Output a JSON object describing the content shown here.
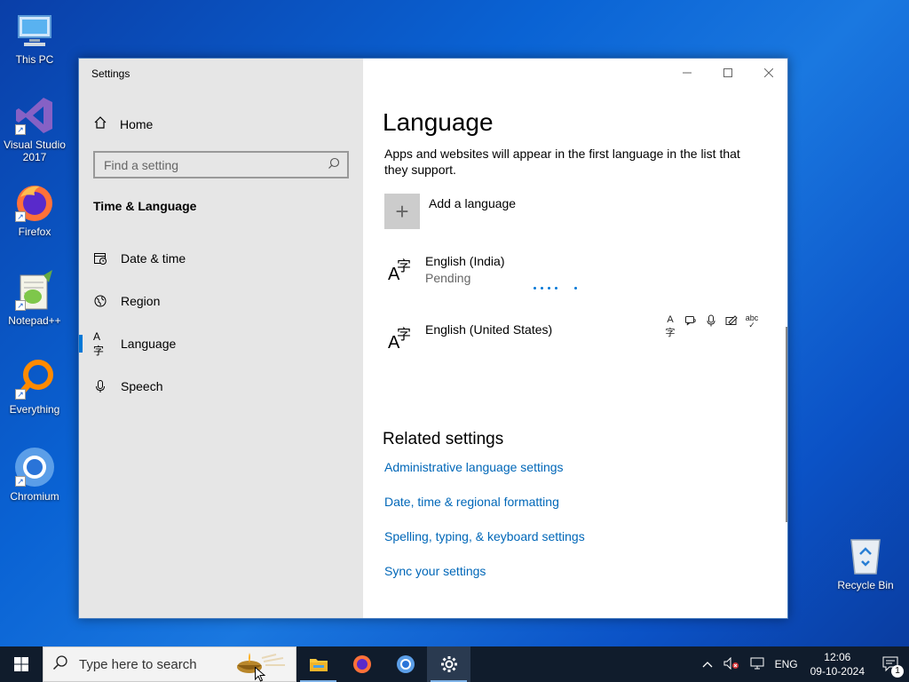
{
  "desktop": {
    "icons": [
      {
        "label": "This PC",
        "icon": "this-pc-icon"
      },
      {
        "label": "Visual Studio 2017",
        "icon": "visual-studio-icon"
      },
      {
        "label": "Firefox",
        "icon": "firefox-icon"
      },
      {
        "label": "Notepad++",
        "icon": "notepad-plus-plus-icon"
      },
      {
        "label": "Everything",
        "icon": "everything-icon"
      },
      {
        "label": "Chromium",
        "icon": "chromium-icon"
      },
      {
        "label": "Recycle Bin",
        "icon": "recycle-bin-icon"
      }
    ]
  },
  "window": {
    "title": "Settings",
    "sidebar": {
      "home_label": "Home",
      "search_placeholder": "Find a setting",
      "section_title": "Time & Language",
      "items": [
        {
          "label": "Date & time",
          "icon": "calendar-clock-icon"
        },
        {
          "label": "Region",
          "icon": "globe-icon"
        },
        {
          "label": "Language",
          "icon": "language-icon",
          "active": true
        },
        {
          "label": "Speech",
          "icon": "microphone-icon"
        }
      ]
    },
    "content": {
      "title": "Language",
      "description": "Apps and websites will appear in the first language in the list that they support.",
      "add_language_label": "Add a language",
      "languages": [
        {
          "name": "English (India)",
          "status": "Pending"
        },
        {
          "name": "English (United States)",
          "status": ""
        }
      ],
      "feature_icons": [
        "display-language-icon",
        "text-to-speech-icon",
        "speech-recognition-icon",
        "handwriting-icon",
        "spellcheck-icon"
      ],
      "related_title": "Related settings",
      "related_links": [
        "Administrative language settings",
        "Date, time & regional formatting",
        "Spelling, typing, & keyboard settings",
        "Sync your settings"
      ]
    }
  },
  "taskbar": {
    "search_placeholder": "Type here to search",
    "apps": [
      "file-explorer-icon",
      "firefox-icon",
      "chromium-icon",
      "settings-gear-icon"
    ],
    "tray": {
      "language": "ENG",
      "time": "12:06",
      "date": "09-10-2024",
      "notification_count": "1"
    }
  },
  "colors": {
    "accent": "#0078d7",
    "link": "#0067b8",
    "sidebar_bg": "#e6e6e6",
    "taskbar_bg": "#101c2c"
  }
}
